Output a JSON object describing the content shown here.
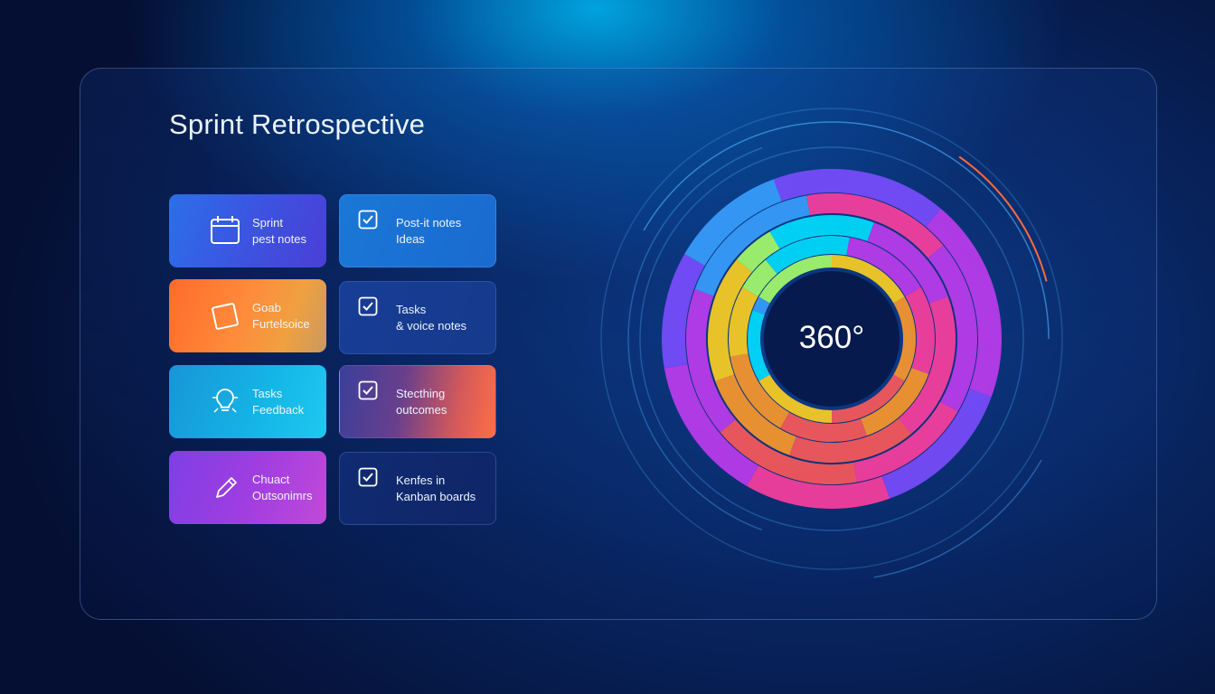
{
  "header": {
    "title": "Sprint Retrospective"
  },
  "cards": [
    {
      "icon": "calendar-icon",
      "line1": "Sprint",
      "line2": "pest notes"
    },
    {
      "icon": "checkbox-icon",
      "line1": "Post-it notes",
      "line2": "Ideas"
    },
    {
      "icon": "sticky-note-icon",
      "line1": "Goab",
      "line2": "Furtelsoice"
    },
    {
      "icon": "checkbox-icon",
      "line1": "Tasks",
      "line2": "& voice notes"
    },
    {
      "icon": "lightbulb-icon",
      "line1": "Tasks",
      "line2": "Feedback"
    },
    {
      "icon": "checkbox-icon",
      "line1": "Stecthing",
      "line2": "outcomes"
    },
    {
      "icon": "pencil-icon",
      "line1": "Chuact",
      "line2": "Outsonimrs"
    },
    {
      "icon": "checkbox-icon",
      "line1": "Kenfes in",
      "line2": "Kanban boards"
    }
  ],
  "radial": {
    "center_label": "360°",
    "colors": [
      "#00e0ff",
      "#3aa0ff",
      "#7b4dff",
      "#c03cf0",
      "#ff3fa0",
      "#ff5a5a",
      "#ff9a2a",
      "#ffd21f",
      "#a8ff6a"
    ]
  }
}
